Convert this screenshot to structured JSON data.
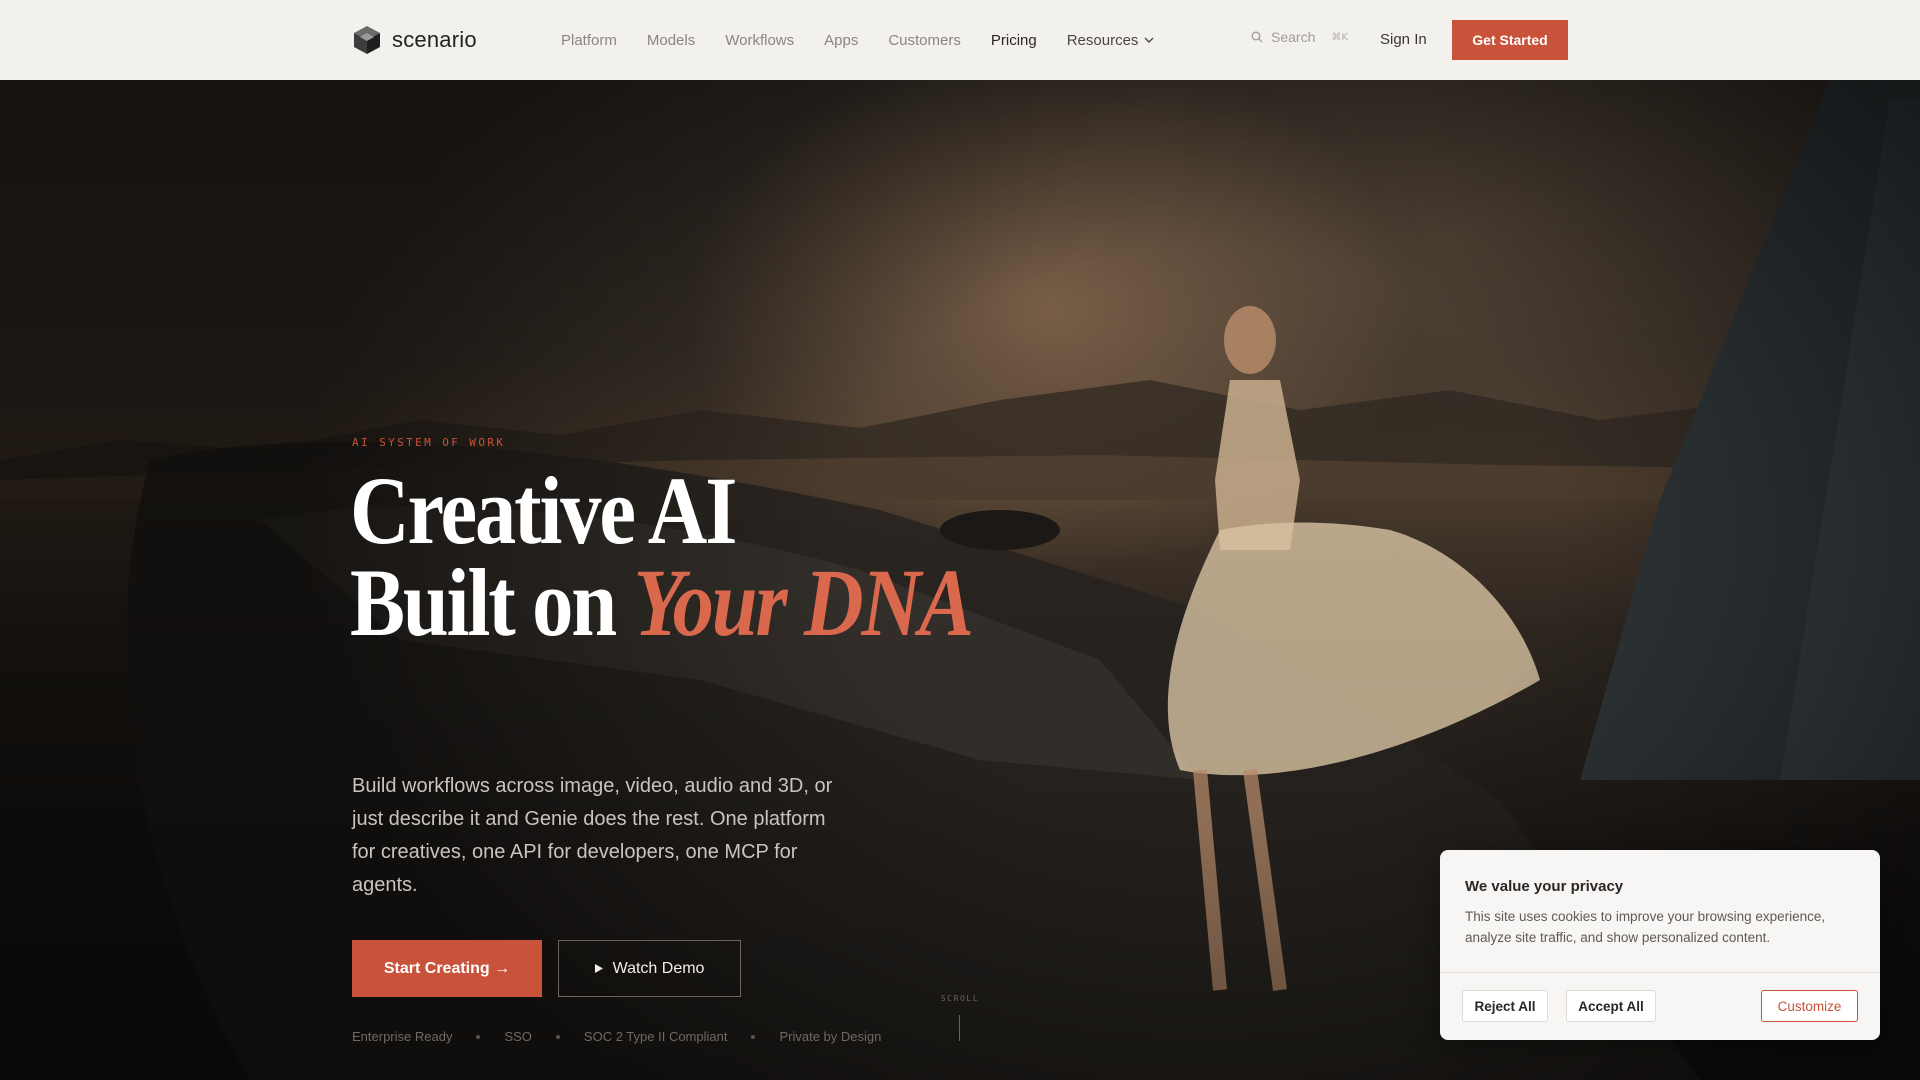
{
  "brand": {
    "name": "scenario",
    "accent": "#c8523a"
  },
  "nav": {
    "items": [
      {
        "label": "Platform"
      },
      {
        "label": "Models"
      },
      {
        "label": "Workflows"
      },
      {
        "label": "Apps"
      },
      {
        "label": "Customers"
      },
      {
        "label": "Pricing"
      },
      {
        "label": "Resources"
      }
    ],
    "search_label": "Search",
    "search_shortcut": "⌘K",
    "sign_in": "Sign In",
    "get_started": "Get Started"
  },
  "hero": {
    "eyebrow": "AI SYSTEM OF WORK",
    "headline_line1": "Creative AI",
    "headline_line2_plain": "Built on",
    "headline_line2_accent": "Your DNA",
    "subcopy": "Build workflows across image, video, audio and 3D, or just describe it and Genie does the rest. One platform for creatives, one API for developers, one MCP for agents.",
    "primary_cta": "Start Creating →",
    "secondary_cta": "Watch Demo",
    "badges": [
      "Enterprise Ready",
      "SSO",
      "SOC 2 Type II Compliant",
      "Private by Design"
    ],
    "scroll_label": "SCROLL"
  },
  "cookie": {
    "title": "We value your privacy",
    "body": "This site uses cookies to improve your browsing experience, analyze site traffic, and show personalized content.",
    "reject": "Reject All",
    "accept": "Accept All",
    "customize": "Customize"
  }
}
